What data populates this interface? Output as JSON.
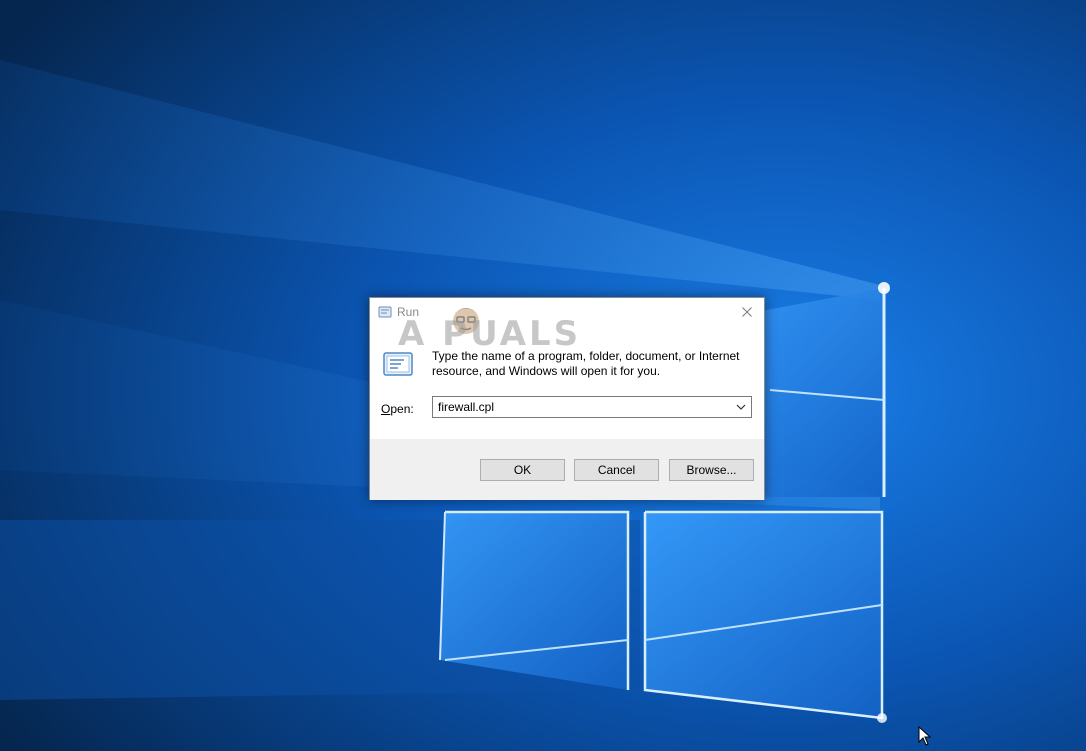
{
  "desktop": {
    "wallpaper": "Windows 10 default hero wallpaper",
    "colors": {
      "background_dark": "#05264f",
      "background_mid": "#0b56b4",
      "glow": "#7ec4ff"
    }
  },
  "run_dialog": {
    "title": "Run",
    "close_icon": "close-icon",
    "watermark": "A PUALS",
    "description": "Type the name of a program, folder, document, or Internet resource, and Windows will open it for you.",
    "open_label_accel": "O",
    "open_label_rest": "pen:",
    "open_value": "firewall.cpl",
    "buttons": {
      "ok": "OK",
      "cancel": "Cancel",
      "browse": "Browse..."
    },
    "icons": {
      "run": "run-icon",
      "dropdown": "chevron-down-icon"
    }
  }
}
